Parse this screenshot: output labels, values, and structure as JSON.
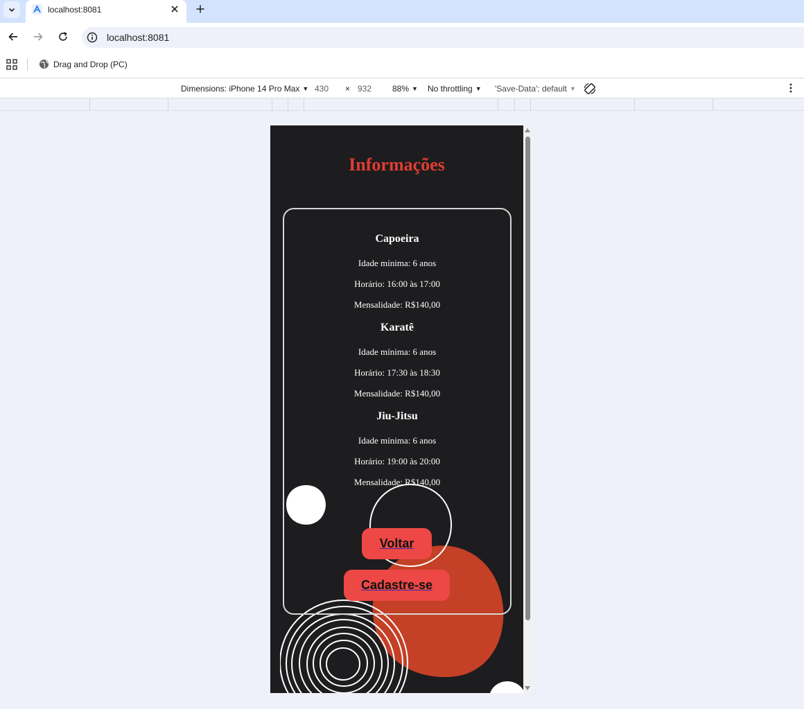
{
  "browser": {
    "tab_title": "localhost:8081",
    "url": "localhost:8081",
    "bookmark_label": "Drag and Drop (PC)"
  },
  "devtools": {
    "dimensions_label": "Dimensions: iPhone 14 Pro Max",
    "width": "430",
    "times": "×",
    "height": "932",
    "zoom": "88%",
    "throttling": "No throttling",
    "save_data": "'Save-Data': default"
  },
  "page": {
    "title": "Informações",
    "sports": [
      {
        "name": "Capoeira",
        "idade": "Idade mínima: 6 anos",
        "horario": "Horário: 16:00 às 17:00",
        "mensalidade": "Mensalidade: R$140,00"
      },
      {
        "name": "Karatê",
        "idade": "Idade mínima: 6 anos",
        "horario": "Horário: 17:30 às 18:30",
        "mensalidade": "Mensalidade: R$140,00"
      },
      {
        "name": "Jiu-Jitsu",
        "idade": "Idade mínima: 6 anos",
        "horario": "Horário: 19:00 às 20:00",
        "mensalidade": "Mensalidade: R$140,00"
      }
    ],
    "buttons": {
      "voltar": "Voltar",
      "cadastro": "Cadastre-se"
    }
  },
  "colors": {
    "accent": "#e03d32",
    "button": "#ed4845",
    "page_bg": "#1d1c1e",
    "blob": "#c44026"
  }
}
